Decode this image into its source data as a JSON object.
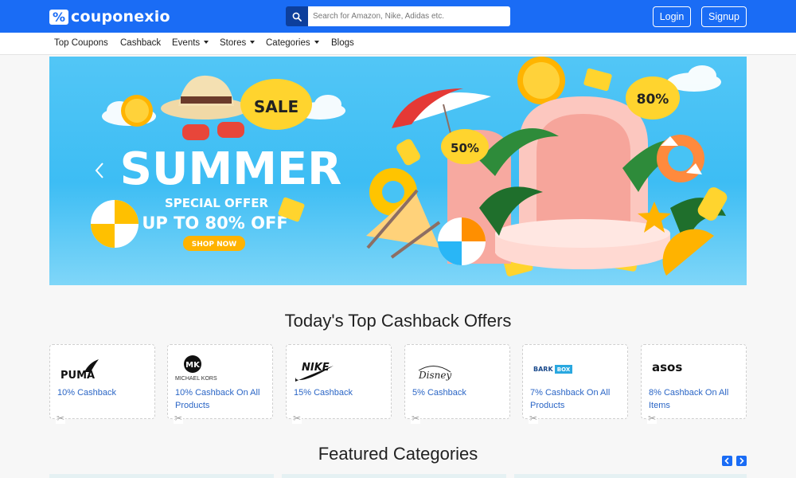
{
  "brand": {
    "logo_mark": "%",
    "name": "couponexio"
  },
  "search": {
    "placeholder": "Search for Amazon, Nike, Adidas etc.",
    "icon": "search-icon"
  },
  "auth": {
    "login": "Login",
    "signup": "Signup"
  },
  "nav": [
    "Top Coupons",
    "Cashback",
    "Events",
    "Stores",
    "Categories",
    "Blogs"
  ],
  "banner": {
    "headline": "SUMMER",
    "subline": "SPECIAL OFFER",
    "offer": "UP TO 80% OFF",
    "cta": "SHOP NOW",
    "tags": [
      "SALE",
      "50%",
      "80%"
    ]
  },
  "sections": {
    "cashback_title": "Today's Top Cashback Offers",
    "categories_title": "Featured Categories"
  },
  "cashback_offers": [
    {
      "store": "PUMA",
      "text": "10% Cashback"
    },
    {
      "store": "MICHAEL KORS",
      "logo_mark": "MK",
      "text": "10% Cashback On All Products"
    },
    {
      "store": "NIKE",
      "text": "15% Cashback"
    },
    {
      "store": "Disney",
      "text": "5% Cashback"
    },
    {
      "store": "BARK BOX",
      "text": "7% Cashback On All Products"
    },
    {
      "store": "asos",
      "text": "8% Cashback On All Items"
    }
  ],
  "colors": {
    "primary": "#1a6cf5",
    "search_button": "#0d3f9c",
    "link": "#2b66c6"
  }
}
